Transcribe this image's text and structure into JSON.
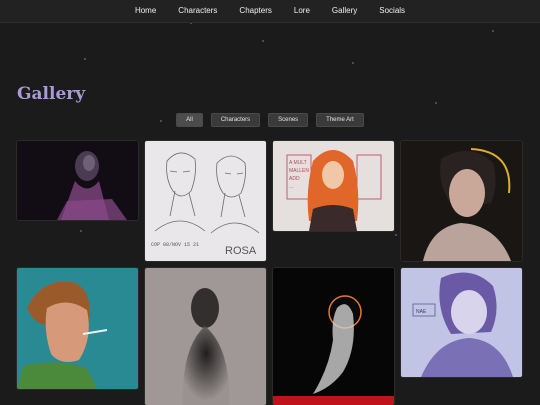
{
  "nav": {
    "items": [
      {
        "label": "Home"
      },
      {
        "label": "Characters"
      },
      {
        "label": "Chapters"
      },
      {
        "label": "Lore"
      },
      {
        "label": "Gallery"
      },
      {
        "label": "Socials"
      }
    ]
  },
  "page": {
    "title": "Gallery"
  },
  "filters": [
    {
      "label": "All",
      "active": true
    },
    {
      "label": "Characters",
      "active": false
    },
    {
      "label": "Scenes",
      "active": false
    },
    {
      "label": "Theme Art",
      "active": false
    }
  ],
  "artworks": {
    "art2": {
      "sketch_label": "ROSA",
      "date_note": "COP 08/NOV 15 21"
    },
    "art3": {
      "note_text": [
        "A MULT",
        "MALLEN",
        "ADD",
        "..."
      ]
    },
    "art8": {
      "note_text": "NAE"
    }
  },
  "colors": {
    "background": "#1b1b1b",
    "nav_bg": "#222222",
    "title": "#a99bd8",
    "button_bg": "#3a3a3a"
  }
}
